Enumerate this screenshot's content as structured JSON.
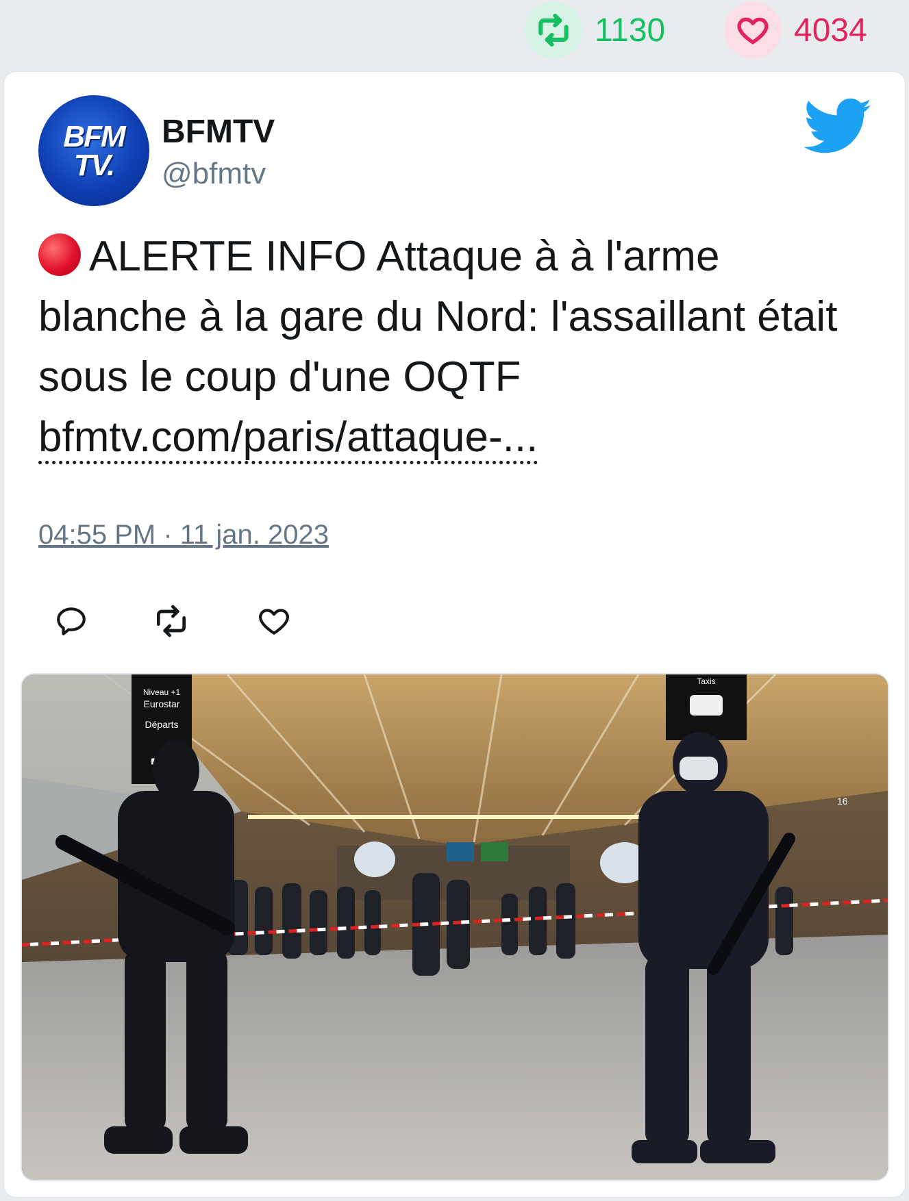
{
  "stats": {
    "retweets": "1130",
    "likes": "4034",
    "retweet_color": "#17bf63",
    "like_color": "#e0245e"
  },
  "tweet": {
    "avatar_text_line1": "BFM",
    "avatar_text_line2": "TV.",
    "author_name": "BFMTV",
    "author_handle": "@bfmtv",
    "text": "ALERTE INFO Attaque à à l'arme blanche à la gare du Nord: l'assaillant était sous le coup d'une OQTF",
    "link": "bfmtv.com/paris/attaque-...",
    "timestamp": "04:55 PM · 11 jan. 2023",
    "accent_color": "#1da1f2"
  },
  "photo": {
    "signs": {
      "left_sign_line1": "Niveau +1",
      "left_sign_line2": "Eurostar",
      "left_sign_line3": "Départs",
      "right_sign": "Taxis",
      "platform_number": "16"
    }
  },
  "icons": {
    "stat_retweet": "retweet-icon",
    "stat_like": "heart-icon",
    "brand": "twitter-bird-icon",
    "alert": "red-circle-icon",
    "reply": "reply-icon",
    "retweet": "retweet-icon",
    "like": "heart-icon"
  }
}
